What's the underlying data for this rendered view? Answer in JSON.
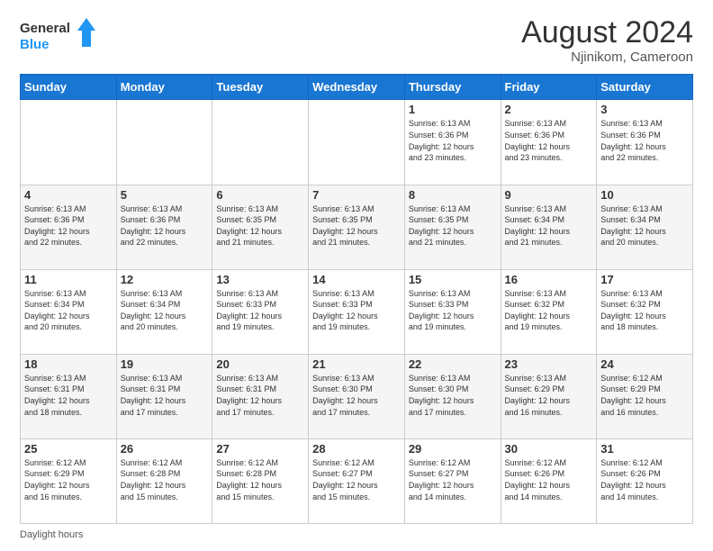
{
  "header": {
    "logo_line1": "General",
    "logo_line2": "Blue",
    "month_title": "August 2024",
    "location": "Njinikom, Cameroon"
  },
  "weekdays": [
    "Sunday",
    "Monday",
    "Tuesday",
    "Wednesday",
    "Thursday",
    "Friday",
    "Saturday"
  ],
  "footer": {
    "daylight_label": "Daylight hours"
  },
  "weeks": [
    [
      {
        "day": "",
        "info": ""
      },
      {
        "day": "",
        "info": ""
      },
      {
        "day": "",
        "info": ""
      },
      {
        "day": "",
        "info": ""
      },
      {
        "day": "1",
        "info": "Sunrise: 6:13 AM\nSunset: 6:36 PM\nDaylight: 12 hours\nand 23 minutes."
      },
      {
        "day": "2",
        "info": "Sunrise: 6:13 AM\nSunset: 6:36 PM\nDaylight: 12 hours\nand 23 minutes."
      },
      {
        "day": "3",
        "info": "Sunrise: 6:13 AM\nSunset: 6:36 PM\nDaylight: 12 hours\nand 22 minutes."
      }
    ],
    [
      {
        "day": "4",
        "info": "Sunrise: 6:13 AM\nSunset: 6:36 PM\nDaylight: 12 hours\nand 22 minutes."
      },
      {
        "day": "5",
        "info": "Sunrise: 6:13 AM\nSunset: 6:36 PM\nDaylight: 12 hours\nand 22 minutes."
      },
      {
        "day": "6",
        "info": "Sunrise: 6:13 AM\nSunset: 6:35 PM\nDaylight: 12 hours\nand 21 minutes."
      },
      {
        "day": "7",
        "info": "Sunrise: 6:13 AM\nSunset: 6:35 PM\nDaylight: 12 hours\nand 21 minutes."
      },
      {
        "day": "8",
        "info": "Sunrise: 6:13 AM\nSunset: 6:35 PM\nDaylight: 12 hours\nand 21 minutes."
      },
      {
        "day": "9",
        "info": "Sunrise: 6:13 AM\nSunset: 6:34 PM\nDaylight: 12 hours\nand 21 minutes."
      },
      {
        "day": "10",
        "info": "Sunrise: 6:13 AM\nSunset: 6:34 PM\nDaylight: 12 hours\nand 20 minutes."
      }
    ],
    [
      {
        "day": "11",
        "info": "Sunrise: 6:13 AM\nSunset: 6:34 PM\nDaylight: 12 hours\nand 20 minutes."
      },
      {
        "day": "12",
        "info": "Sunrise: 6:13 AM\nSunset: 6:34 PM\nDaylight: 12 hours\nand 20 minutes."
      },
      {
        "day": "13",
        "info": "Sunrise: 6:13 AM\nSunset: 6:33 PM\nDaylight: 12 hours\nand 19 minutes."
      },
      {
        "day": "14",
        "info": "Sunrise: 6:13 AM\nSunset: 6:33 PM\nDaylight: 12 hours\nand 19 minutes."
      },
      {
        "day": "15",
        "info": "Sunrise: 6:13 AM\nSunset: 6:33 PM\nDaylight: 12 hours\nand 19 minutes."
      },
      {
        "day": "16",
        "info": "Sunrise: 6:13 AM\nSunset: 6:32 PM\nDaylight: 12 hours\nand 19 minutes."
      },
      {
        "day": "17",
        "info": "Sunrise: 6:13 AM\nSunset: 6:32 PM\nDaylight: 12 hours\nand 18 minutes."
      }
    ],
    [
      {
        "day": "18",
        "info": "Sunrise: 6:13 AM\nSunset: 6:31 PM\nDaylight: 12 hours\nand 18 minutes."
      },
      {
        "day": "19",
        "info": "Sunrise: 6:13 AM\nSunset: 6:31 PM\nDaylight: 12 hours\nand 17 minutes."
      },
      {
        "day": "20",
        "info": "Sunrise: 6:13 AM\nSunset: 6:31 PM\nDaylight: 12 hours\nand 17 minutes."
      },
      {
        "day": "21",
        "info": "Sunrise: 6:13 AM\nSunset: 6:30 PM\nDaylight: 12 hours\nand 17 minutes."
      },
      {
        "day": "22",
        "info": "Sunrise: 6:13 AM\nSunset: 6:30 PM\nDaylight: 12 hours\nand 17 minutes."
      },
      {
        "day": "23",
        "info": "Sunrise: 6:13 AM\nSunset: 6:29 PM\nDaylight: 12 hours\nand 16 minutes."
      },
      {
        "day": "24",
        "info": "Sunrise: 6:12 AM\nSunset: 6:29 PM\nDaylight: 12 hours\nand 16 minutes."
      }
    ],
    [
      {
        "day": "25",
        "info": "Sunrise: 6:12 AM\nSunset: 6:29 PM\nDaylight: 12 hours\nand 16 minutes."
      },
      {
        "day": "26",
        "info": "Sunrise: 6:12 AM\nSunset: 6:28 PM\nDaylight: 12 hours\nand 15 minutes."
      },
      {
        "day": "27",
        "info": "Sunrise: 6:12 AM\nSunset: 6:28 PM\nDaylight: 12 hours\nand 15 minutes."
      },
      {
        "day": "28",
        "info": "Sunrise: 6:12 AM\nSunset: 6:27 PM\nDaylight: 12 hours\nand 15 minutes."
      },
      {
        "day": "29",
        "info": "Sunrise: 6:12 AM\nSunset: 6:27 PM\nDaylight: 12 hours\nand 14 minutes."
      },
      {
        "day": "30",
        "info": "Sunrise: 6:12 AM\nSunset: 6:26 PM\nDaylight: 12 hours\nand 14 minutes."
      },
      {
        "day": "31",
        "info": "Sunrise: 6:12 AM\nSunset: 6:26 PM\nDaylight: 12 hours\nand 14 minutes."
      }
    ]
  ]
}
